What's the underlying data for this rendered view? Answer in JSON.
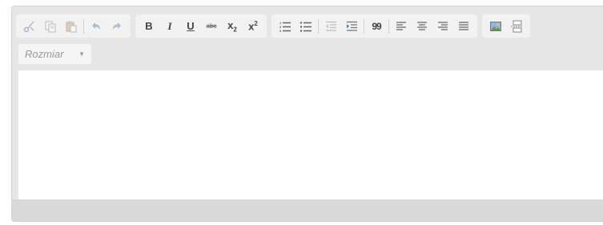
{
  "editor": {
    "font_size_dropdown": {
      "label": "Rozmiar"
    },
    "toolbar_groups": [
      {
        "items": [
          "cut-icon",
          "copy-icon",
          "paste-icon",
          "separator",
          "undo-icon",
          "redo-icon"
        ]
      },
      {
        "items": [
          "bold-icon",
          "italic-icon",
          "underline-icon",
          "strikethrough-icon",
          "subscript-icon",
          "superscript-icon"
        ]
      },
      {
        "items": [
          "numbered-list-icon",
          "bulleted-list-icon",
          "separator",
          "outdent-icon",
          "indent-icon",
          "separator",
          "blockquote-icon",
          "separator",
          "align-left-icon",
          "align-center-icon",
          "align-right-icon",
          "align-justify-icon"
        ]
      },
      {
        "items": [
          "image-icon",
          "page-break-icon"
        ]
      }
    ],
    "format_labels": {
      "bold": "B",
      "italic": "I",
      "underline": "U",
      "strike": "abc",
      "subscript_base": "x",
      "subscript_index": "2",
      "superscript_base": "x",
      "superscript_index": "2",
      "blockquote": "99"
    },
    "colors": {
      "toolbar_bg": "#e6e6e6",
      "group_bg": "#f2f2f2",
      "content_bg": "#ffffff",
      "bottom_bar_bg": "#d9d9d9"
    }
  }
}
